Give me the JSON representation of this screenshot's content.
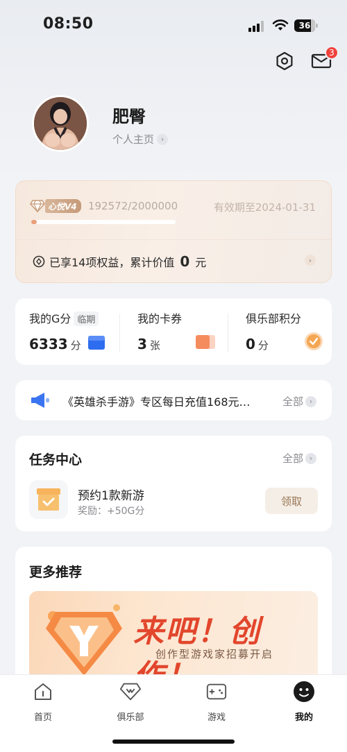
{
  "status_bar": {
    "time": "08:50",
    "battery": "36"
  },
  "header": {
    "mail_badge": "3"
  },
  "profile": {
    "name": "肥臀",
    "homepage_link": "个人主页"
  },
  "vip": {
    "level": "心悦V4",
    "progress_text": "192572/2000000",
    "progress_fraction": 0.096,
    "expiry": "有效期至2024-01-31",
    "benefit_prefix": "已享14项权益，累计价值",
    "benefit_value": "0",
    "benefit_unit": "元"
  },
  "stats": [
    {
      "label": "我的G分",
      "tag": "临期",
      "value": "6333",
      "unit": "分",
      "icon": "blue-card-icon"
    },
    {
      "label": "我的卡券",
      "value": "3",
      "unit": "张",
      "icon": "coupon-icon"
    },
    {
      "label": "俱乐部积分",
      "value": "0",
      "unit": "分",
      "icon": "points-coin-icon"
    }
  ],
  "notice": {
    "text": "《英雄杀手游》专区每日充值168元…",
    "all_label": "全部"
  },
  "tasks": {
    "title": "任务中心",
    "all_label": "全部",
    "items": [
      {
        "name": "预约1款新游",
        "reward": "奖励：+50G分",
        "action": "领取"
      }
    ]
  },
  "recommend": {
    "title": "更多推荐",
    "banner_title": "来吧！创作！",
    "banner_sub": "创作型游戏家招募开启"
  },
  "nav": [
    {
      "label": "首页",
      "icon": "home-icon"
    },
    {
      "label": "俱乐部",
      "icon": "diamond-icon"
    },
    {
      "label": "游戏",
      "icon": "gamepad-icon"
    },
    {
      "label": "我的",
      "icon": "profile-face-icon",
      "active": true
    }
  ],
  "colors": {
    "accent_orange": "#e9a07a",
    "badge_red": "#f0413b",
    "banner_red": "#e2462c"
  }
}
